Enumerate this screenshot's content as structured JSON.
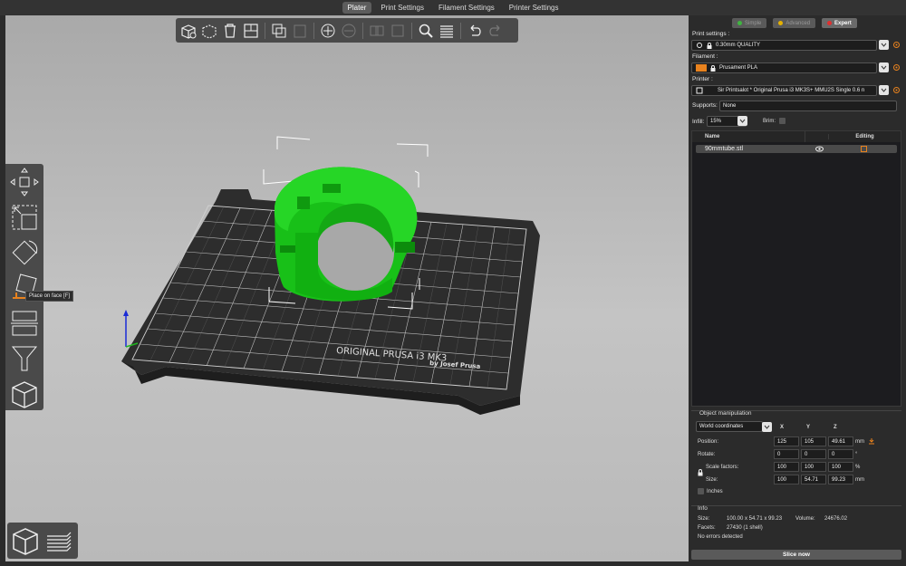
{
  "tabs": [
    "Plater",
    "Print Settings",
    "Filament Settings",
    "Printer Settings"
  ],
  "active_tab": "Plater",
  "tooltip": "Place on face [F]",
  "bed_text": {
    "line1": "ORIGINAL PRUSA i3  MK3",
    "line2": "by Josef Prusa"
  },
  "modes": [
    {
      "label": "Simple",
      "color": "#3fb540",
      "active": false
    },
    {
      "label": "Advanced",
      "color": "#e5b100",
      "active": false
    },
    {
      "label": "Expert",
      "color": "#e03030",
      "active": true
    }
  ],
  "print_settings": {
    "label": "Print settings :",
    "value": "0.30mm QUALITY"
  },
  "filament": {
    "label": "Filament :",
    "value": "Prusament PLA",
    "color": "#e8821e"
  },
  "printer": {
    "label": "Printer :",
    "value": "Sir Printsalot * Original Prusa i3 MK3S+ MMU2S Single 0.6 n"
  },
  "supports": {
    "label": "Supports:",
    "value": "None"
  },
  "infill": {
    "label": "Infill:",
    "value": "15%"
  },
  "brim": {
    "label": "Brim:"
  },
  "object_list": {
    "col_name": "Name",
    "col_editing": "Editing",
    "items": [
      "90mmtube.stl"
    ]
  },
  "object_manipulation": {
    "title": "Object manipulation",
    "coord_system": "World coordinates",
    "axes": [
      "X",
      "Y",
      "Z"
    ],
    "position": {
      "label": "Position:",
      "values": [
        "125",
        "105",
        "49.61"
      ],
      "unit": "mm"
    },
    "rotate": {
      "label": "Rotate:",
      "values": [
        "0",
        "0",
        "0"
      ],
      "unit": "°"
    },
    "scale": {
      "label": "Scale factors:",
      "values": [
        "100",
        "100",
        "100"
      ],
      "unit": "%"
    },
    "size": {
      "label": "Size:",
      "values": [
        "100",
        "54.71",
        "99.23"
      ],
      "unit": "mm"
    },
    "inches": "Inches"
  },
  "info": {
    "title": "Info",
    "size_label": "Size:",
    "size_value": "100.00 x 54.71 x 99.23",
    "volume_label": "Volume:",
    "volume_value": "24676.02",
    "facets_label": "Facets:",
    "facets_value": "27430 (1 shell)",
    "errors": "No errors detected"
  },
  "slice_button": "Slice now",
  "colors": {
    "model": "#19c419",
    "bed": "#2d2d2d",
    "accent": "#e8821e"
  }
}
